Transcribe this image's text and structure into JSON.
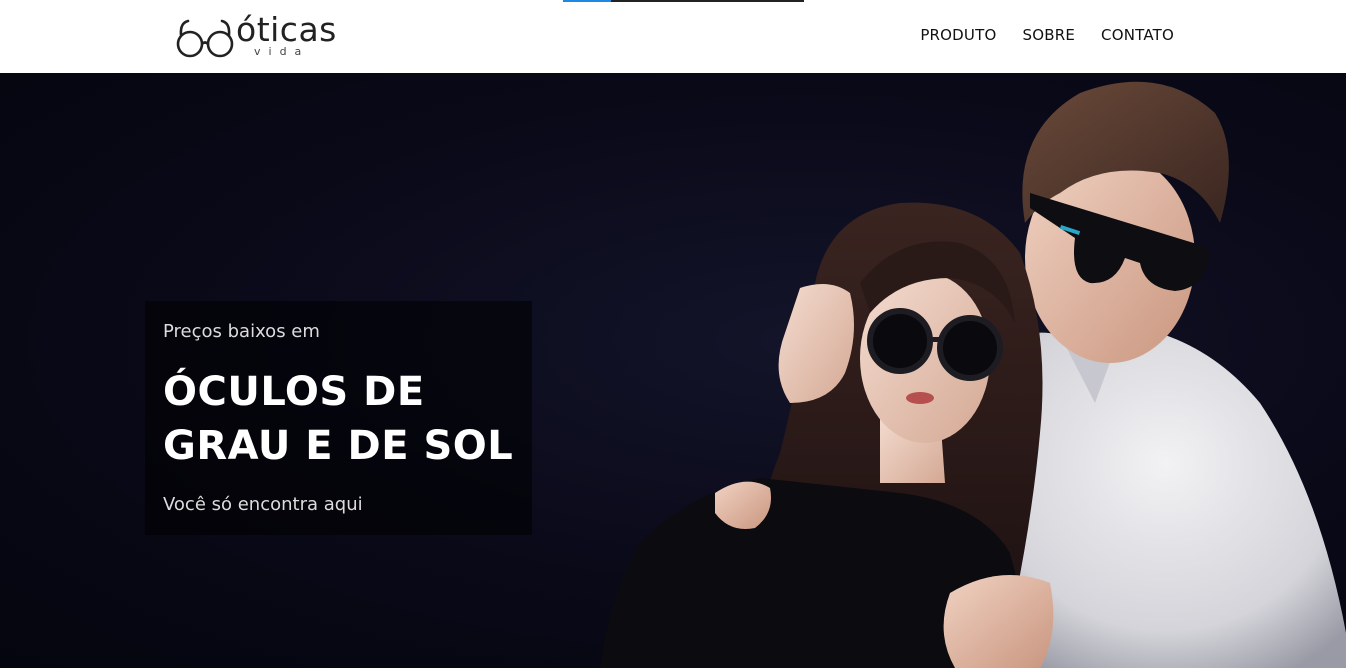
{
  "brand": {
    "name": "óticas",
    "tagline": "vida"
  },
  "nav": {
    "items": [
      {
        "label": "PRODUTO"
      },
      {
        "label": "SOBRE"
      },
      {
        "label": "CONTATO"
      }
    ]
  },
  "hero": {
    "kicker": "Preços baixos em",
    "title_line1": "ÓCULOS DE",
    "title_line2": "GRAU E DE SOL",
    "subtitle": "Você só encontra aqui"
  },
  "colors": {
    "hero_background": "#0a0a1a",
    "accent": "#1e88e5",
    "nav_text": "#111111"
  },
  "icons": {
    "logo": "eyeglasses-icon"
  }
}
